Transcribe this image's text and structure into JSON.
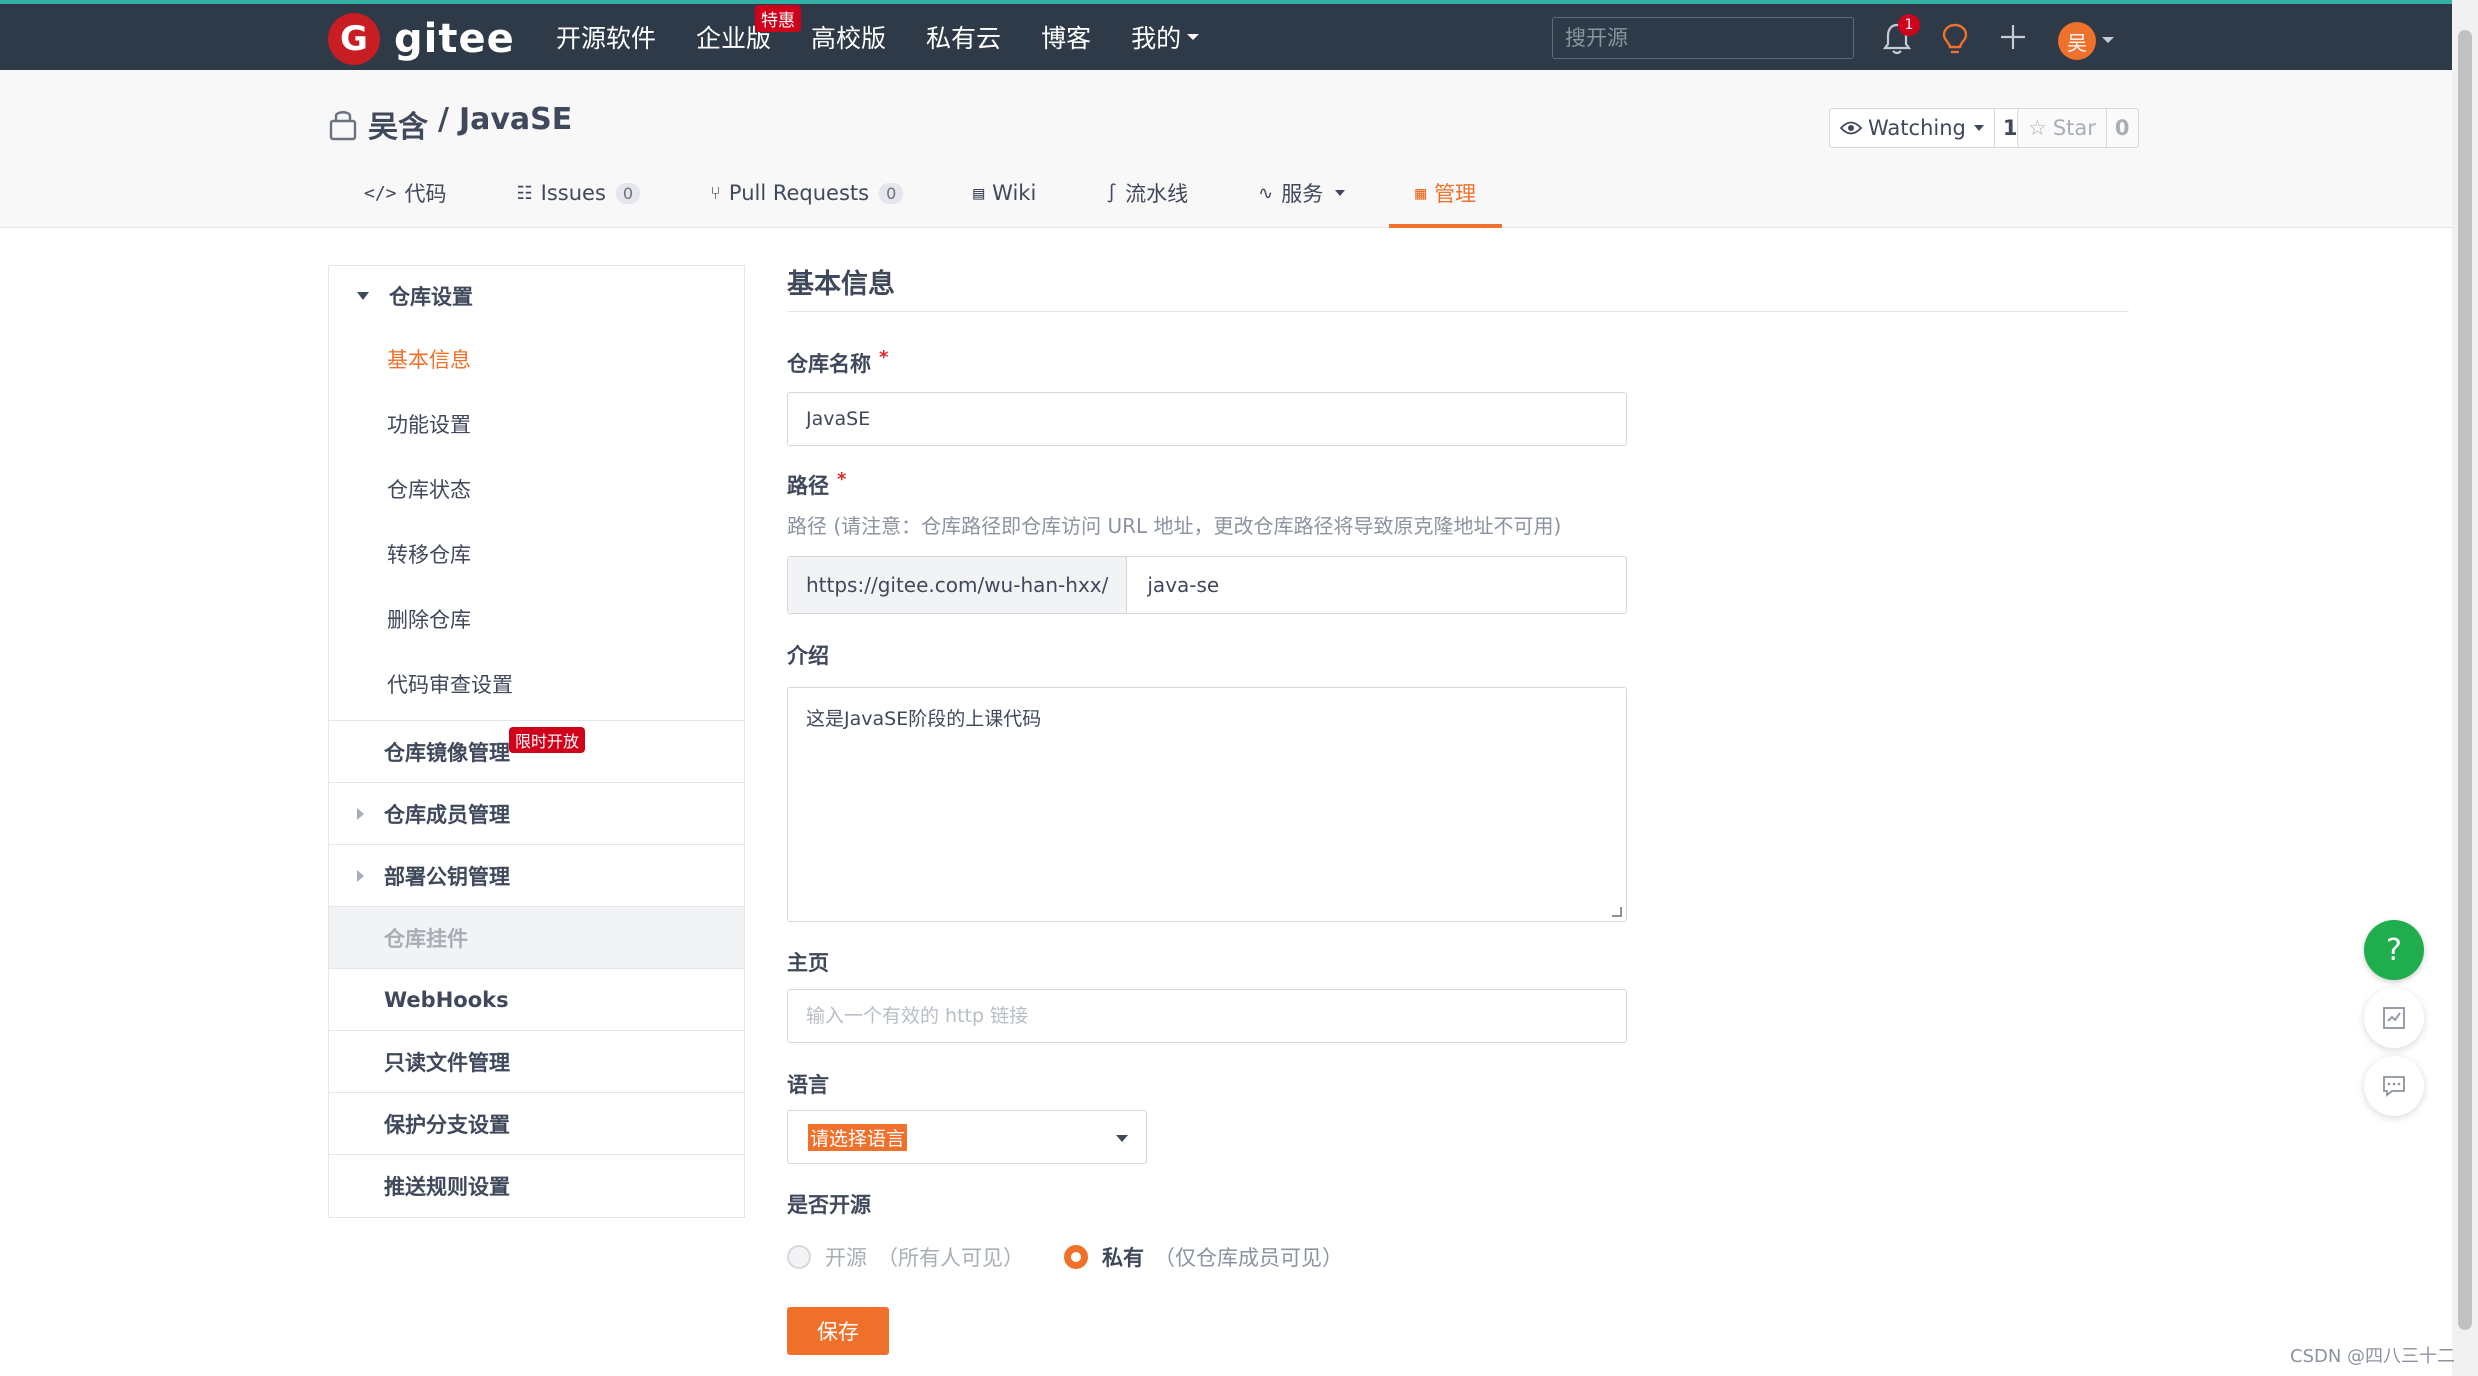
{
  "colors": {
    "navbar_bg": "#2e3a47",
    "accent": "#f0712c",
    "logo": "#c71d23",
    "required": "#db2828",
    "badge_red": "#d0021b",
    "help_green": "#1fad4e"
  },
  "navbar": {
    "logo_text": "gitee",
    "nav_items": [
      {
        "label": "开源软件"
      },
      {
        "label": "企业版",
        "badge": "特惠"
      },
      {
        "label": "高校版"
      },
      {
        "label": "私有云"
      },
      {
        "label": "博客"
      },
      {
        "label": "我的",
        "dropdown": true
      }
    ],
    "search_placeholder": "搜开源",
    "notification_count": "1",
    "avatar_text": "吴"
  },
  "repo": {
    "owner": "吴含",
    "separator": "/",
    "name": "JavaSE",
    "watch_label": "Watching",
    "watch_count": "1",
    "star_label": "Star",
    "star_count": "0"
  },
  "tabs": [
    {
      "label": "代码",
      "icon": "code-icon"
    },
    {
      "label": "Issues",
      "icon": "issues-icon",
      "count": "0"
    },
    {
      "label": "Pull Requests",
      "icon": "pull-request-icon",
      "count": "0"
    },
    {
      "label": "Wiki",
      "icon": "wiki-icon"
    },
    {
      "label": "流水线",
      "icon": "pipeline-icon"
    },
    {
      "label": "服务",
      "icon": "pulse-icon",
      "dropdown": true
    },
    {
      "label": "管理",
      "icon": "manage-icon",
      "active": true
    }
  ],
  "sidebar": {
    "group_title": "仓库设置",
    "subitems": [
      {
        "label": "基本信息",
        "active": true
      },
      {
        "label": "功能设置"
      },
      {
        "label": "仓库状态"
      },
      {
        "label": "转移仓库"
      },
      {
        "label": "删除仓库"
      },
      {
        "label": "代码审查设置"
      }
    ],
    "items": [
      {
        "label": "仓库镜像管理",
        "badge": "限时开放",
        "kind": "plain"
      },
      {
        "label": "仓库成员管理",
        "kind": "arrow"
      },
      {
        "label": "部署公钥管理",
        "kind": "arrow"
      },
      {
        "label": "仓库挂件",
        "kind": "disabled"
      },
      {
        "label": "WebHooks",
        "kind": "plain"
      },
      {
        "label": "只读文件管理",
        "kind": "plain"
      },
      {
        "label": "保护分支设置",
        "kind": "plain"
      },
      {
        "label": "推送规则设置",
        "kind": "plain"
      }
    ]
  },
  "form": {
    "section_title": "基本信息",
    "name_label": "仓库名称",
    "name_value": "JavaSE",
    "path_label": "路径",
    "path_hint": "路径 (请注意：仓库路径即仓库访问 URL 地址，更改仓库路径将导致原克隆地址不可用)",
    "path_prefix": "https://gitee.com/wu-han-hxx/",
    "path_value": "java-se",
    "intro_label": "介绍",
    "intro_value": "这是JavaSE阶段的上课代码",
    "homepage_label": "主页",
    "homepage_placeholder": "输入一个有效的 http 链接",
    "language_label": "语言",
    "language_value": "请选择语言",
    "open_label": "是否开源",
    "open_option": "开源",
    "open_desc": "（所有人可见）",
    "private_option": "私有",
    "private_desc": "（仅仓库成员可见）",
    "save_label": "保存"
  },
  "float": {
    "help_symbol": "?"
  },
  "watermark": "CSDN @四八三十二"
}
